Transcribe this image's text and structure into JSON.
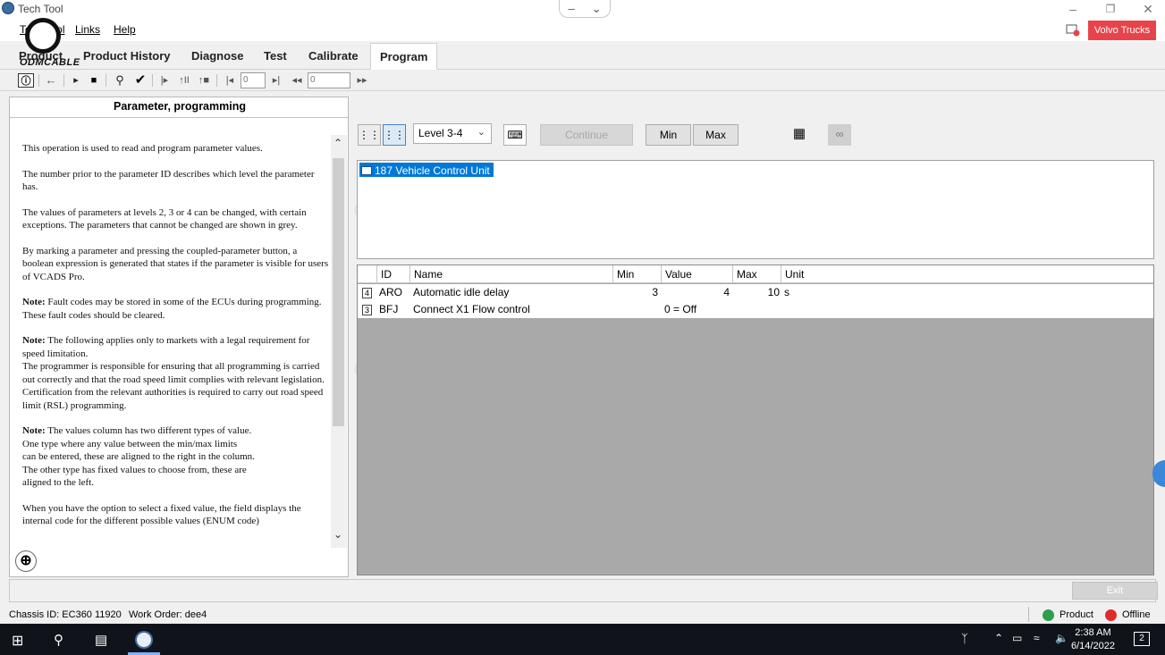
{
  "window": {
    "title": "Tech Tool",
    "brand": "Volvo Trucks"
  },
  "menu": [
    {
      "label": "Tech Tool"
    },
    {
      "label": "Links"
    },
    {
      "label": "Help"
    }
  ],
  "logo": {
    "text": "ODMCABLE"
  },
  "tabs": [
    {
      "label": "Product"
    },
    {
      "label": "Product History"
    },
    {
      "label": "Diagnose"
    },
    {
      "label": "Test"
    },
    {
      "label": "Calibrate"
    },
    {
      "label": "Program",
      "active": true
    }
  ],
  "toolbar": {
    "step_value": "0",
    "goto_value": "0"
  },
  "help": {
    "title": "Parameter, programming",
    "p1": "This operation is used to read and program parameter values.",
    "p2": "The number prior to the parameter ID describes which level the parameter has.",
    "p3": "The values of parameters at levels 2, 3 or 4 can be changed, with certain exceptions. The parameters that cannot be changed are shown in grey.",
    "p4": "By marking a parameter and pressing the coupled-parameter button, a boolean expression is generated that states if the parameter is visible for users of VCADS Pro.",
    "note_label": "Note:",
    "p5": "Fault codes may be stored in some of the ECUs during programming. These fault codes should be cleared.",
    "p6a": "The following applies only to markets with a legal requirement for speed limitation.",
    "p6b": "The programmer is responsible for ensuring that all programming is carried out correctly and that the road speed limit complies with relevant legislation. Certification from the relevant authorities is required to carry out road speed limit (RSL) programming.",
    "p7a": "The values column has two different types of value.",
    "p7b": "One type where any value between the min/max limits",
    "p7c": "can be entered, these are aligned to the right in the column.",
    "p7d": "The other type has fixed values to choose from, these are",
    "p7e": "aligned to the left.",
    "p8": "When you have the option to select a fixed value, the field displays the internal code for the different possible values (ENUM code)"
  },
  "controls": {
    "level": "Level 3-4",
    "continue": "Continue",
    "min": "Min",
    "max": "Max"
  },
  "ecu": {
    "label": "187  Vehicle Control Unit"
  },
  "params": {
    "headers": {
      "id": "ID",
      "name": "Name",
      "min": "Min",
      "value": "Value",
      "max": "Max",
      "unit": "Unit"
    },
    "rows": [
      {
        "level": "4",
        "id": "ARO",
        "name": "Automatic idle delay",
        "min": "3",
        "value": "4",
        "max": "10",
        "unit": "s"
      },
      {
        "level": "3",
        "id": "BFJ",
        "name": "Connect  X1 Flow control",
        "min": "",
        "value": "0 = Off",
        "max": "",
        "unit": ""
      }
    ]
  },
  "exit": {
    "label": "Exit"
  },
  "status": {
    "chassis": "Chassis ID: EC360 11920",
    "work_order": "Work Order: dee4",
    "product": "Product",
    "offline": "Offline",
    "product_color": "#2e9e4e",
    "offline_color": "#e02b2b"
  },
  "taskbar": {
    "time": "2:38 AM",
    "date": "6/14/2022",
    "notifications": "2"
  }
}
